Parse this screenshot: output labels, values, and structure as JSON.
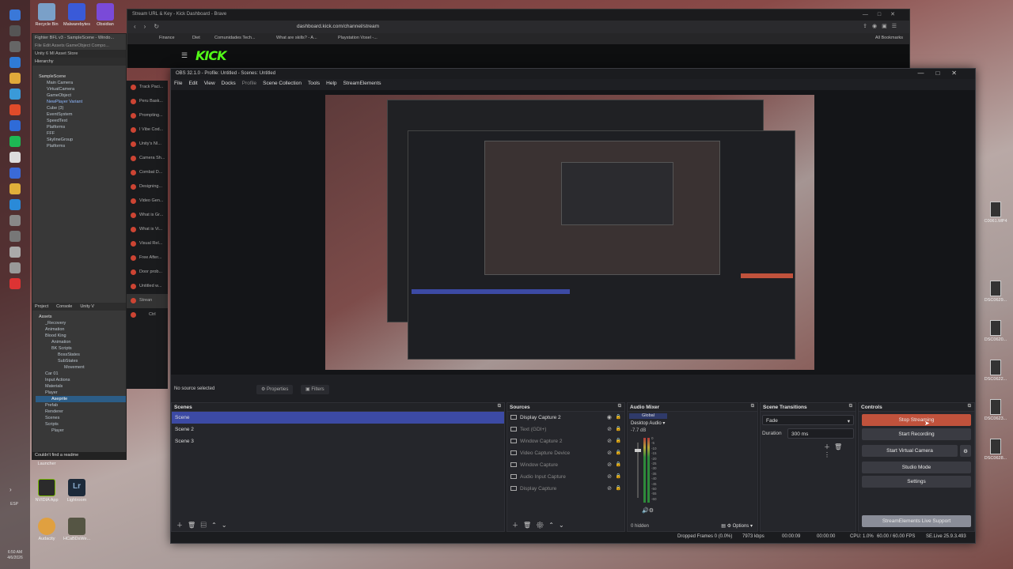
{
  "desktop": {
    "icons_top": [
      "Recycle Bin",
      "Malwarebytes",
      "Obsidian"
    ],
    "icons_bottom": [
      "Launcher",
      "NVIDIA App",
      "Lightroom",
      "Audacity",
      "HCaBDsWe..."
    ],
    "icons_right": [
      "C0061.MP4",
      "DSC0629...",
      "DSC0620...",
      "DSC0622...",
      "DSC0623...",
      "DSC0628..."
    ],
    "tray_lang": "ESP",
    "clock_time": "6:50 AM",
    "clock_date": "4/6/2026",
    "toast": "Couldn't find a readme"
  },
  "browser": {
    "title": "Stream URL & Key - Kick Dashboard - Brave",
    "url": "dashboard.kick.com/channel/stream",
    "bookmarks": [
      "Finance",
      "Diet",
      "Comunidades Tech...",
      "What are skills? - A...",
      "Playstation Vosel -..."
    ],
    "all_bookmarks": "All Bookmarks",
    "kick_logo": "KICK",
    "kick_sidebar": [
      "Track Paci...",
      "Peru Bask...",
      "Prompting...",
      "I Vibe Cod...",
      "Unity's NI...",
      "Camera Sh...",
      "Combat D...",
      "Designing...",
      "Video Gen...",
      "What is Gr...",
      "What is Vi...",
      "Visual Rel...",
      "Free After...",
      "Door prob...",
      "Untitled w...",
      "Strean"
    ],
    "kick_side_bottom": "Ctrl"
  },
  "unity": {
    "title": "Fighter BFL v3 - SampleScene - Windo...",
    "menu": "File  Edit  Assets  GameObject  Compo...",
    "toolbar": "Unity 6   MI   Asset Store",
    "hierarchy_label": "Hierarchy",
    "hierarchy": [
      "SampleScene",
      "Main Camera",
      "VirtualCamera",
      "GameObject",
      "NewPlayer Variant",
      "Cube (3)",
      "EventSystem",
      "SpeedText",
      "Platforms",
      "FFF",
      "SkylineGroup",
      "Platforms"
    ],
    "tabs": [
      "Project",
      "Console",
      "Unity V"
    ],
    "project": [
      "Assets",
      "_Recovery",
      "Animation",
      "Blood King",
      "Animation",
      "BK Scripts",
      "BossStates",
      "SubStates",
      "Movement",
      "Car 01",
      "Input Actions",
      "Materials",
      "Player",
      "Aseprite",
      "Prefab",
      "Renderer",
      "Scenes",
      "Scripts",
      "Player"
    ]
  },
  "obs": {
    "title": "OBS 32.1.0 - Profile: Untitled - Scenes: Untitled",
    "menu": [
      "File",
      "Edit",
      "View",
      "Docks",
      "Profile",
      "Scene Collection",
      "Tools",
      "Help",
      "StreamElements"
    ],
    "no_source": "No source selected",
    "properties": "Properties",
    "filters": "Filters",
    "scenes": {
      "title": "Scenes",
      "items": [
        "Scene",
        "Scene 2",
        "Scene 3"
      ],
      "selected": "Scene"
    },
    "sources": {
      "title": "Sources",
      "items": [
        {
          "name": "Display Capture 2",
          "visible": true
        },
        {
          "name": "Text (GDI+)",
          "visible": false
        },
        {
          "name": "Window Capture 2",
          "visible": false
        },
        {
          "name": "Video Capture Device",
          "visible": false
        },
        {
          "name": "Window Capture",
          "visible": false
        },
        {
          "name": "Audio Input Capture",
          "visible": false
        },
        {
          "name": "Display Capture",
          "visible": false
        }
      ]
    },
    "mixer": {
      "title": "Audio Mixer",
      "global": "Global",
      "channel": "Desktop Audio",
      "db": "-7.7 dB",
      "scale": [
        "0",
        "-5",
        "-10",
        "-15",
        "-20",
        "-25",
        "-30",
        "-35",
        "-40",
        "-45",
        "-50",
        "-55",
        "-60"
      ],
      "hidden": "0 hidden",
      "options": "Options"
    },
    "transitions": {
      "title": "Scene Transitions",
      "type": "Fade",
      "duration_label": "Duration",
      "duration": "300 ms"
    },
    "controls": {
      "title": "Controls",
      "stop_streaming": "Stop Streaming",
      "start_recording": "Start Recording",
      "start_virtual_camera": "Start Virtual Camera",
      "studio_mode": "Studio Mode",
      "settings": "Settings",
      "support": "StreamElements Live Support"
    },
    "status": {
      "dropped": "Dropped Frames 0 (0.0%)",
      "kbps": "7973 kbps",
      "stream_time": "00:00:09",
      "rec_time": "00:00:00",
      "cpu": "CPU: 1.0%",
      "fps": "60.00 / 60.00 FPS",
      "se": "SE.Live 25.9.3.493"
    }
  },
  "colors": {
    "accent_selected": "#3c4aa4",
    "stop_button": "#c0523c",
    "kick_green": "#53fc18"
  }
}
